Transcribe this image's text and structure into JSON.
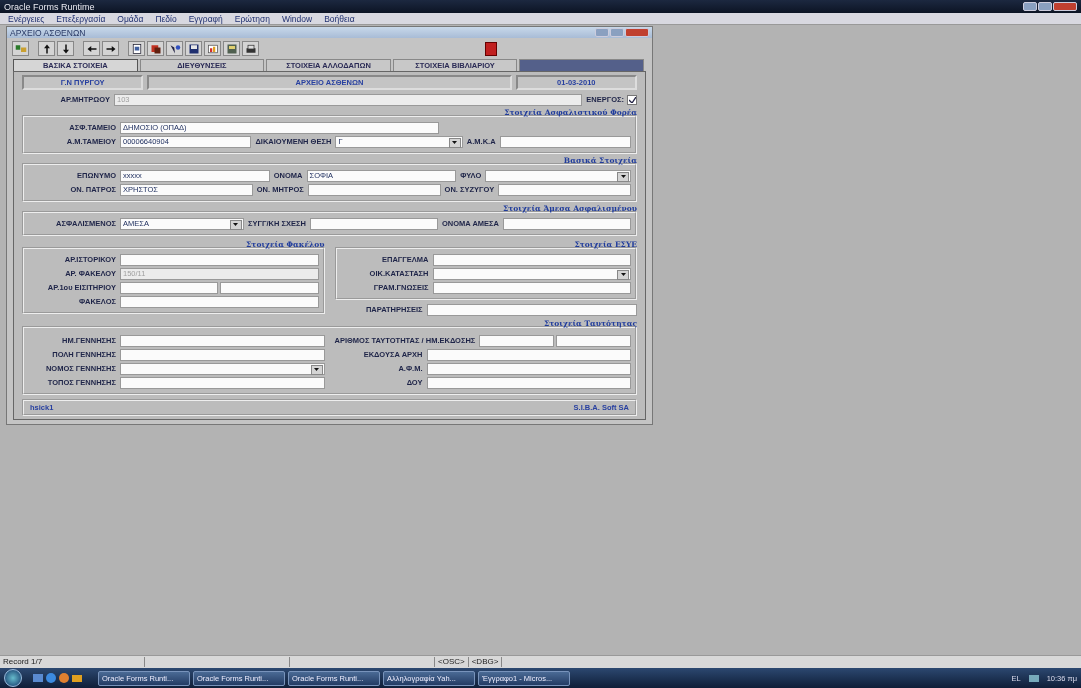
{
  "app": {
    "title": "Oracle Forms Runtime"
  },
  "menu": [
    "Ενέργειες",
    "Επεξεργασία",
    "Ομάδα",
    "Πεδίο",
    "Εγγραφή",
    "Ερώτηση",
    "Window",
    "Βοήθεια"
  ],
  "form_window": {
    "title": "ΑΡΧΕΙΟ ΑΣΘΕΝΩΝ"
  },
  "tabs": [
    {
      "label": "ΒΑΣΙΚΑ ΣΤΟΙΧΕΙΑ",
      "selected": true
    },
    {
      "label": "ΔΙΕΥΘΥΝΣΕΙΣ",
      "selected": false
    },
    {
      "label": "ΣΤΟΙΧΕΙΑ ΑΛΛΟΔΑΠΩΝ",
      "selected": false
    },
    {
      "label": "ΣΤΟΙΧΕΙΑ ΒΙΒΛΙΑΡΙΟΥ",
      "selected": false
    },
    {
      "selected": false
    }
  ],
  "header": [
    "Γ.Ν ΠΥΡΓΟΥ",
    "ΑΡΧΕΙΟ ΑΣΘΕΝΩΝ",
    "01-03-2010"
  ],
  "groups": [
    {
      "kind": "plain",
      "rows": [
        [
          {
            "kind": "text",
            "label": "ΑΡ.ΜΗΤΡΩΟΥ",
            "value": "103",
            "disabled": true
          },
          {
            "kind": "check",
            "label": "ΕΝΕΡΓΟΣ:",
            "checked": true
          }
        ]
      ]
    },
    {
      "kind": "box",
      "title": "Στοιχεία Ασφαλιστικού Φορέα",
      "rows": [
        [
          {
            "kind": "text",
            "label": "ΑΣΦ.ΤΑΜΕΙΟ",
            "value": "ΔΗΜΟΣΙΟ (ΟΠΑΔ)"
          },
          {
            "kind": "spacer"
          }
        ],
        [
          {
            "kind": "text",
            "label": "Α.Μ.ΤΑΜΕΙΟΥ",
            "value": "00006640904"
          },
          {
            "kind": "dropdown",
            "label": "ΔΙΚΑΙΟΥΜΕΝΗ ΘΕΣΗ",
            "value": "Γ"
          },
          {
            "kind": "text",
            "label": "Α.Μ.Κ.Α"
          }
        ]
      ]
    },
    {
      "kind": "box",
      "title": "Βασικά Στοιχεία",
      "rows": [
        [
          {
            "kind": "text",
            "label": "ΕΠΩΝΥΜΟ",
            "value": "xxxxx"
          },
          {
            "kind": "text",
            "label": "ΟΝΟΜΑ",
            "value": "ΣΟΦΙΑ"
          },
          {
            "kind": "dropdown",
            "label": "ΦΥΛΟ"
          }
        ],
        [
          {
            "kind": "text",
            "label": "ΟΝ. ΠΑΤΡΟΣ",
            "value": "ΧΡΗΣΤΟΣ"
          },
          {
            "kind": "text",
            "label": "ΟΝ. ΜΗΤΡΟΣ"
          },
          {
            "kind": "text",
            "label": "ΟΝ. ΣΥΖΥΓΟΥ"
          }
        ]
      ]
    },
    {
      "kind": "box",
      "title": "Στοιχεία Άμεσα Ασφαλισμένου",
      "rows": [
        [
          {
            "kind": "dropdown",
            "label": "ΑΣΦΑΛΙΣΜΕΝΟΣ",
            "value": "ΑΜΕΣΑ"
          },
          {
            "kind": "text",
            "label": "ΣΥΓΓ/ΚΗ ΣΧΕΣΗ"
          },
          {
            "kind": "text",
            "label": "ΟΝΟΜΑ ΑΜΕΣΑ"
          }
        ]
      ]
    },
    {
      "kind": "split",
      "columns": [
        [
          {
            "kind": "box",
            "title": "Στοιχεία Φακέλου",
            "rows": [
              [
                {
                  "kind": "text",
                  "label": "ΑΡ.ΙΣΤΟΡΙΚΟΥ"
                }
              ],
              [
                {
                  "kind": "text",
                  "label": "ΑΡ. ΦΑΚΕΛΟΥ",
                  "value": "150/11",
                  "disabled": true
                }
              ],
              [
                {
                  "kind": "pair",
                  "label": "ΑΡ.1ου ΕΙΣΙΤΗΡΙΟΥ"
                }
              ],
              [
                {
                  "kind": "text",
                  "label": "ΦΑΚΕΛΟΣ"
                }
              ]
            ]
          }
        ],
        [
          {
            "kind": "box",
            "title": "Στοιχεία ΕΣΥΕ",
            "rows": [
              [
                {
                  "kind": "text",
                  "label": "ΕΠΑΓΓΕΛΜΑ"
                }
              ],
              [
                {
                  "kind": "dropdown",
                  "label": "ΟΙΚ.ΚΑΤΑΣΤΑΣΗ"
                }
              ],
              [
                {
                  "kind": "text",
                  "label": "ΓΡΑΜ.ΓΝΩΣΕΙΣ"
                }
              ]
            ]
          },
          {
            "kind": "plain",
            "rows": [
              [
                {
                  "kind": "text",
                  "label": "ΠΑΡΑΤΗΡΗΣΕΙΣ"
                }
              ]
            ]
          }
        ]
      ]
    },
    {
      "kind": "box",
      "title": "Στοιχεία Ταυτότητας",
      "columns": [
        [
          {
            "kind": "plain",
            "rows": [
              [
                {
                  "kind": "text",
                  "label": "ΗΜ.ΓΕΝΝΗΣΗΣ"
                }
              ],
              [
                {
                  "kind": "text",
                  "label": "ΠΟΛΗ ΓΕΝΝΗΣΗΣ"
                }
              ],
              [
                {
                  "kind": "dropdown",
                  "label": "ΝΟΜΟΣ ΓΕΝΝΗΣΗΣ"
                }
              ],
              [
                {
                  "kind": "text",
                  "label": "ΤΟΠΟΣ ΓΕΝΝΗΣΗΣ"
                }
              ]
            ]
          }
        ],
        [
          {
            "kind": "plain",
            "rows": [
              [
                {
                  "kind": "pair",
                  "label": "ΑΡΙΘΜΟΣ ΤΑΥΤΟΤΗΤΑΣ / ΗΜ.ΕΚΔΟΣΗΣ"
                }
              ],
              [
                {
                  "kind": "text",
                  "label": "ΕΚΔΟΥΣΑ ΑΡΧΗ"
                }
              ],
              [
                {
                  "kind": "text",
                  "label": "Α.Φ.Μ."
                }
              ],
              [
                {
                  "kind": "text",
                  "label": "ΔΟΥ"
                }
              ]
            ]
          }
        ]
      ]
    }
  ],
  "footer": {
    "left": "hsick1",
    "right": "S.I.B.A. Soft SA"
  },
  "status_bar": [
    "Record 1/7",
    "<OSC>",
    "<DBG>"
  ],
  "taskbar": {
    "tasks": [
      "Oracle Forms Runti...",
      "Oracle Forms Runti...",
      "Oracle Forms Runti...",
      "Αλληλογραφία Yah...",
      "Έγγραφο1 - Micros..."
    ],
    "language": "EL",
    "time": "10:36 πμ"
  }
}
